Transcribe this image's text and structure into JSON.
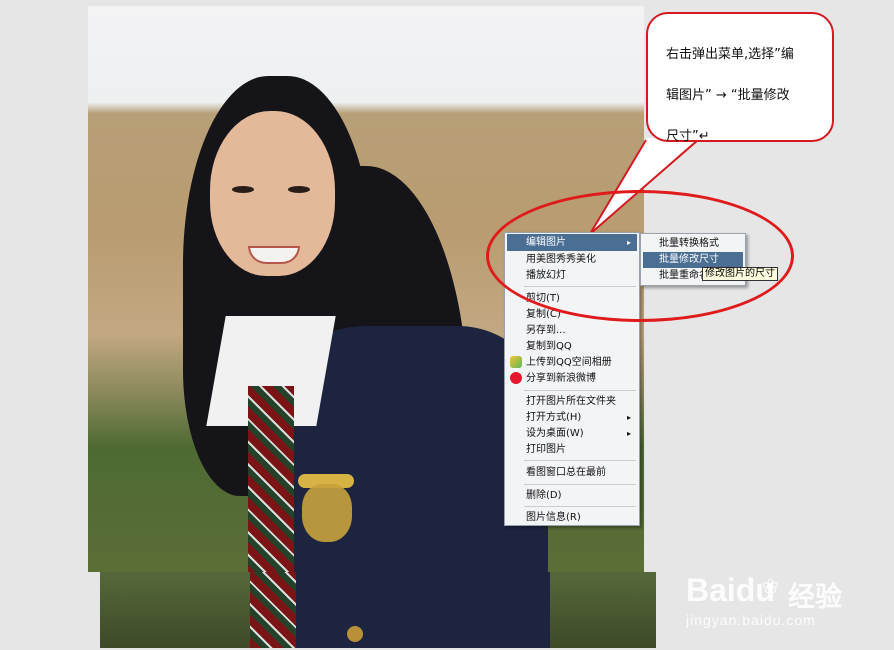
{
  "callout": {
    "line1": "右击弹出菜单,选择”编",
    "line2": "辑图片” → “批量修改",
    "line3": "尺寸”↵"
  },
  "context_menu": {
    "items": [
      {
        "label": "编辑图片",
        "submenu": true,
        "highlighted": true
      },
      {
        "label": "用美图秀秀美化"
      },
      {
        "label": "播放幻灯"
      },
      {
        "label": "剪切(T)"
      },
      {
        "label": "复制(C)"
      },
      {
        "label": "另存到..."
      },
      {
        "label": "复制到QQ"
      },
      {
        "label": "上传到QQ空间相册",
        "icon": "qzone-icon"
      },
      {
        "label": "分享到新浪微博",
        "icon": "weibo-icon"
      },
      {
        "label": "打开图片所在文件夹"
      },
      {
        "label": "打开方式(H)",
        "submenu": true
      },
      {
        "label": "设为桌面(W)",
        "submenu": true
      },
      {
        "label": "打印图片"
      },
      {
        "label": "看图窗口总在最前"
      },
      {
        "label": "删除(D)"
      },
      {
        "label": "图片信息(R)"
      }
    ],
    "submenu_arrow": "▸"
  },
  "submenu": {
    "items": [
      {
        "label": "批量转换格式"
      },
      {
        "label": "批量修改尺寸",
        "highlighted": true
      },
      {
        "label": "批量重命名"
      }
    ]
  },
  "tooltip": {
    "text": "修改图片的尺寸"
  },
  "watermark": {
    "logo": "Bai",
    "logo2": "du",
    "cn": "经验",
    "url": "jingyan.baidu.com"
  },
  "colors": {
    "highlight": "#4a6e94",
    "annotation_red": "#df1b1b"
  }
}
